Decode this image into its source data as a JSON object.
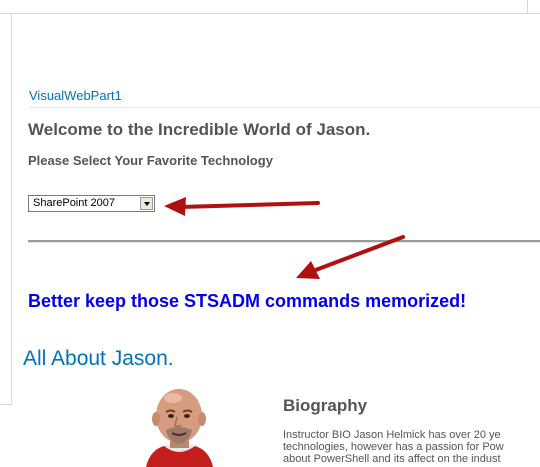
{
  "webpart": {
    "title": "VisualWebPart1",
    "welcome_heading": "Welcome to the Incredible World of Jason.",
    "select_prompt": "Please Select Your Favorite Technology",
    "dropdown_selected": "SharePoint 2007",
    "result_message": "Better keep those STSADM commands memorized!"
  },
  "about": {
    "heading": "All About Jason.",
    "bio_heading": "Biography",
    "bio_lines": [
      "Instructor BIO Jason Helmick has over 20 ye",
      "technologies, however has a passion for Pow",
      "about PowerShell and its affect on the indust"
    ]
  },
  "colors": {
    "link_blue": "#0072bc",
    "message_blue": "#0000ee",
    "heading_gray": "#555555",
    "arrow_red": "#b01010"
  }
}
